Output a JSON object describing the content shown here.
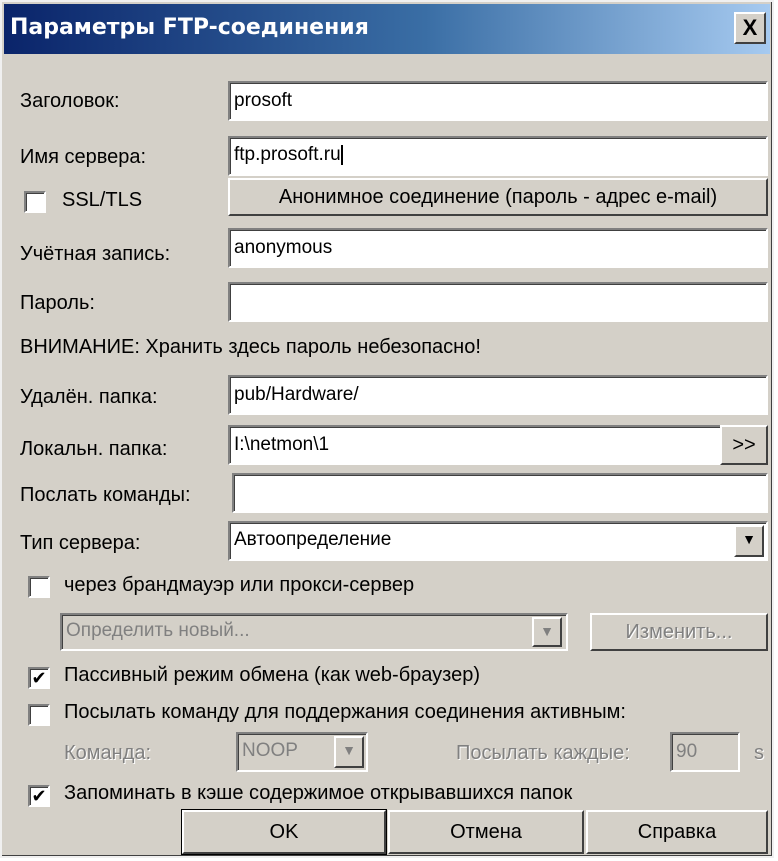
{
  "window": {
    "title": "Параметры FTP-соединения",
    "close_label": "X"
  },
  "fields": {
    "title_label": "Заголовок:",
    "title_value": "prosoft",
    "server_label": "Имя сервера:",
    "server_value": "ftp.prosoft.ru",
    "ssl_label": "SSL/TLS",
    "anon_button": "Анонимное соединение (пароль - адрес e-mail)",
    "account_label": "Учётная запись:",
    "account_value": "anonymous",
    "password_label": "Пароль:",
    "password_value": "",
    "warning": "ВНИМАНИЕ: Хранить здесь пароль небезопасно!",
    "remote_label": "Удалён. папка:",
    "remote_value": "pub/Hardware/",
    "local_label": "Локальн. папка:",
    "local_value": "I:\\netmon\\1",
    "browse_label": ">>",
    "commands_label": "Послать команды:",
    "commands_value": "",
    "server_type_label": "Тип сервера:",
    "server_type_value": "Автоопределение",
    "firewall_label": "через брандмауэр или прокси-сервер",
    "firewall_select": "Определить новый...",
    "change_button": "Изменить...",
    "passive_label": "Пассивный режим обмена (как web-браузер)",
    "keepalive_label": "Посылать команду для поддержания соединения активным:",
    "command_label": "Команда:",
    "command_value": "NOOP",
    "every_label": "Посылать каждые:",
    "every_value": "90",
    "every_unit": "s",
    "cache_label": "Запоминать в кэше содержимое открывавшихся папок"
  },
  "checks": {
    "ssl": false,
    "firewall": false,
    "passive": true,
    "keepalive": false,
    "cache": true
  },
  "buttons": {
    "ok": "OK",
    "cancel": "Отмена",
    "help": "Справка"
  },
  "icons": {
    "close": "close-icon",
    "dropdown": "chevron-down-icon",
    "check": "check-icon"
  }
}
